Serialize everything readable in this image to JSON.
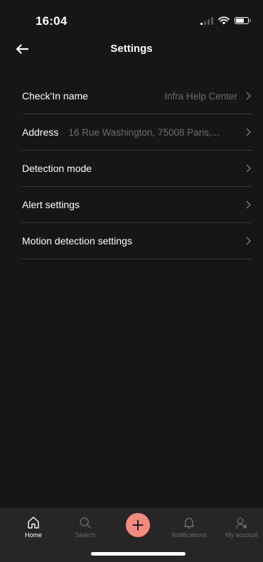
{
  "status_bar": {
    "time": "16:04"
  },
  "header": {
    "title": "Settings",
    "back_icon": "arrow-left-icon"
  },
  "settings": [
    {
      "label": "Check'In name",
      "value": "Infra Help Center"
    },
    {
      "label": "Address",
      "value": "16 Rue Washington, 75008 Paris,..."
    },
    {
      "label": "Detection mode",
      "value": ""
    },
    {
      "label": "Alert settings",
      "value": ""
    },
    {
      "label": "Motion detection settings",
      "value": ""
    }
  ],
  "tab_bar": {
    "home": "Home",
    "search": "Search",
    "notifications": "Notifications",
    "account": "My account",
    "add_icon": "plus-icon"
  },
  "colors": {
    "background": "#161616",
    "accent": "#f28a7d",
    "muted": "#6b6b6b"
  }
}
